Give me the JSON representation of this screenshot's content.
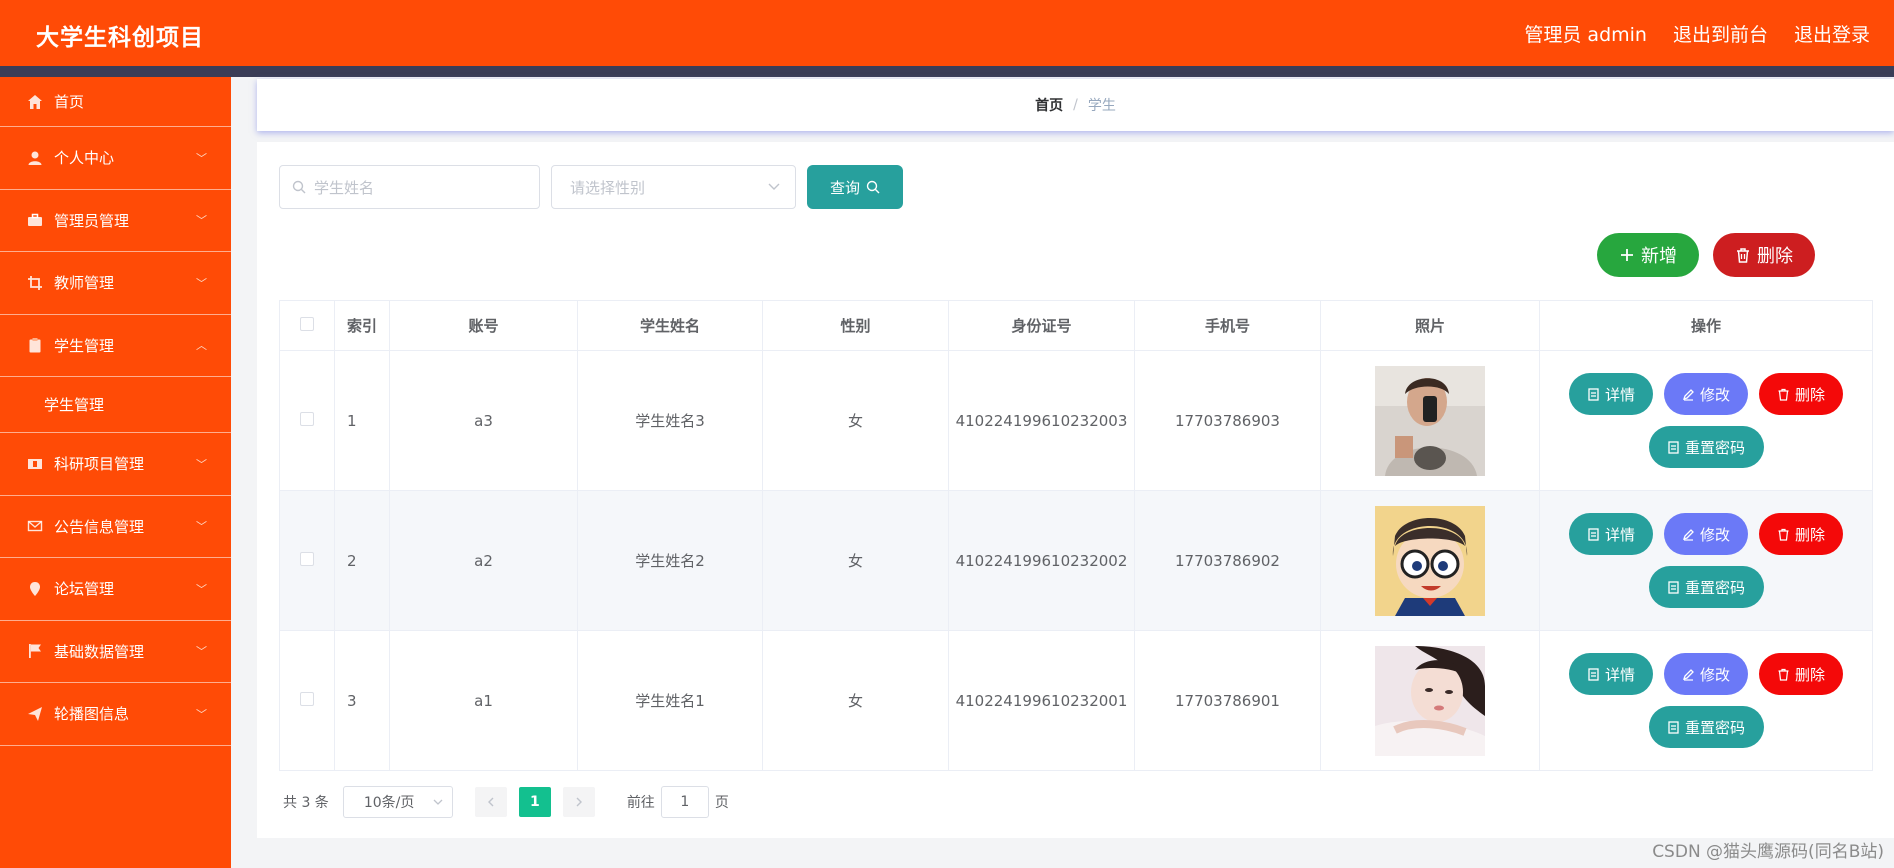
{
  "header": {
    "title": "大学生科创项目",
    "links": [
      "管理员 admin",
      "退出到前台",
      "退出登录"
    ]
  },
  "sidebar": {
    "items": [
      {
        "label": "首页",
        "icon": "home-icon"
      },
      {
        "label": "个人中心",
        "icon": "user-icon"
      },
      {
        "label": "管理员管理",
        "icon": "briefcase-icon"
      },
      {
        "label": "教师管理",
        "icon": "crop-icon"
      },
      {
        "label": "学生管理",
        "icon": "clipboard-icon",
        "expanded": true
      },
      {
        "label": "科研项目管理",
        "icon": "film-icon"
      },
      {
        "label": "公告信息管理",
        "icon": "mail-icon"
      },
      {
        "label": "论坛管理",
        "icon": "location-icon"
      },
      {
        "label": "基础数据管理",
        "icon": "flag-icon"
      },
      {
        "label": "轮播图信息",
        "icon": "send-icon"
      }
    ],
    "submenu": {
      "label": "学生管理"
    }
  },
  "breadcrumb": {
    "home": "首页",
    "separator": "/",
    "current": "学生"
  },
  "search": {
    "name_placeholder": "学生姓名",
    "gender_placeholder": "请选择性别",
    "query_label": "查询"
  },
  "actions": {
    "add_label": "新增",
    "delete_label": "删除"
  },
  "table": {
    "headers": [
      "索引",
      "账号",
      "学生姓名",
      "性别",
      "身份证号",
      "手机号",
      "照片",
      "操作"
    ],
    "rows": [
      {
        "index": "1",
        "account": "a3",
        "name": "学生姓名3",
        "gender": "女",
        "id_number": "410224199610232003",
        "phone": "17703786903"
      },
      {
        "index": "2",
        "account": "a2",
        "name": "学生姓名2",
        "gender": "女",
        "id_number": "410224199610232002",
        "phone": "17703786902"
      },
      {
        "index": "3",
        "account": "a1",
        "name": "学生姓名1",
        "gender": "女",
        "id_number": "410224199610232001",
        "phone": "17703786901"
      }
    ],
    "row_actions": {
      "detail": "详情",
      "edit": "修改",
      "delete": "删除",
      "reset": "重置密码"
    }
  },
  "pagination": {
    "total": "共 3 条",
    "page_size": "10条/页",
    "current_page": "1",
    "goto_prefix": "前往",
    "goto_value": "1",
    "goto_suffix": "页"
  },
  "watermark": "CSDN @猫头鹰源码(同名B站)",
  "colors": {
    "primary": "#ff4b06",
    "teal": "#27a09d",
    "green": "#27a73e",
    "red": "#cd1e20",
    "edit": "#6b79f7",
    "pager_active": "#13c08f"
  }
}
